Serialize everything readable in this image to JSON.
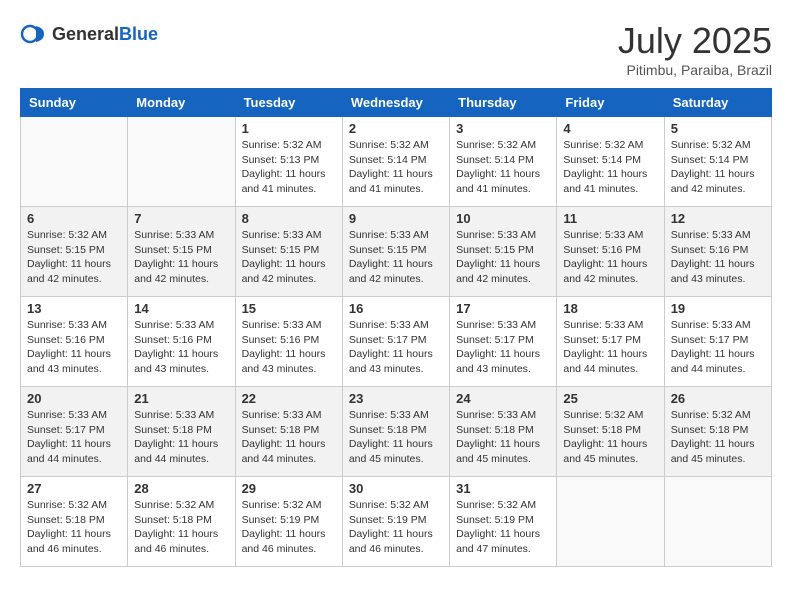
{
  "header": {
    "logo_general": "General",
    "logo_blue": "Blue",
    "month_year": "July 2025",
    "location": "Pitimbu, Paraiba, Brazil"
  },
  "days_of_week": [
    "Sunday",
    "Monday",
    "Tuesday",
    "Wednesday",
    "Thursday",
    "Friday",
    "Saturday"
  ],
  "weeks": [
    [
      {
        "day": "",
        "info": ""
      },
      {
        "day": "",
        "info": ""
      },
      {
        "day": "1",
        "info": "Sunrise: 5:32 AM\nSunset: 5:13 PM\nDaylight: 11 hours\nand 41 minutes."
      },
      {
        "day": "2",
        "info": "Sunrise: 5:32 AM\nSunset: 5:14 PM\nDaylight: 11 hours\nand 41 minutes."
      },
      {
        "day": "3",
        "info": "Sunrise: 5:32 AM\nSunset: 5:14 PM\nDaylight: 11 hours\nand 41 minutes."
      },
      {
        "day": "4",
        "info": "Sunrise: 5:32 AM\nSunset: 5:14 PM\nDaylight: 11 hours\nand 41 minutes."
      },
      {
        "day": "5",
        "info": "Sunrise: 5:32 AM\nSunset: 5:14 PM\nDaylight: 11 hours\nand 42 minutes."
      }
    ],
    [
      {
        "day": "6",
        "info": "Sunrise: 5:32 AM\nSunset: 5:15 PM\nDaylight: 11 hours\nand 42 minutes."
      },
      {
        "day": "7",
        "info": "Sunrise: 5:33 AM\nSunset: 5:15 PM\nDaylight: 11 hours\nand 42 minutes."
      },
      {
        "day": "8",
        "info": "Sunrise: 5:33 AM\nSunset: 5:15 PM\nDaylight: 11 hours\nand 42 minutes."
      },
      {
        "day": "9",
        "info": "Sunrise: 5:33 AM\nSunset: 5:15 PM\nDaylight: 11 hours\nand 42 minutes."
      },
      {
        "day": "10",
        "info": "Sunrise: 5:33 AM\nSunset: 5:15 PM\nDaylight: 11 hours\nand 42 minutes."
      },
      {
        "day": "11",
        "info": "Sunrise: 5:33 AM\nSunset: 5:16 PM\nDaylight: 11 hours\nand 42 minutes."
      },
      {
        "day": "12",
        "info": "Sunrise: 5:33 AM\nSunset: 5:16 PM\nDaylight: 11 hours\nand 43 minutes."
      }
    ],
    [
      {
        "day": "13",
        "info": "Sunrise: 5:33 AM\nSunset: 5:16 PM\nDaylight: 11 hours\nand 43 minutes."
      },
      {
        "day": "14",
        "info": "Sunrise: 5:33 AM\nSunset: 5:16 PM\nDaylight: 11 hours\nand 43 minutes."
      },
      {
        "day": "15",
        "info": "Sunrise: 5:33 AM\nSunset: 5:16 PM\nDaylight: 11 hours\nand 43 minutes."
      },
      {
        "day": "16",
        "info": "Sunrise: 5:33 AM\nSunset: 5:17 PM\nDaylight: 11 hours\nand 43 minutes."
      },
      {
        "day": "17",
        "info": "Sunrise: 5:33 AM\nSunset: 5:17 PM\nDaylight: 11 hours\nand 43 minutes."
      },
      {
        "day": "18",
        "info": "Sunrise: 5:33 AM\nSunset: 5:17 PM\nDaylight: 11 hours\nand 44 minutes."
      },
      {
        "day": "19",
        "info": "Sunrise: 5:33 AM\nSunset: 5:17 PM\nDaylight: 11 hours\nand 44 minutes."
      }
    ],
    [
      {
        "day": "20",
        "info": "Sunrise: 5:33 AM\nSunset: 5:17 PM\nDaylight: 11 hours\nand 44 minutes."
      },
      {
        "day": "21",
        "info": "Sunrise: 5:33 AM\nSunset: 5:18 PM\nDaylight: 11 hours\nand 44 minutes."
      },
      {
        "day": "22",
        "info": "Sunrise: 5:33 AM\nSunset: 5:18 PM\nDaylight: 11 hours\nand 44 minutes."
      },
      {
        "day": "23",
        "info": "Sunrise: 5:33 AM\nSunset: 5:18 PM\nDaylight: 11 hours\nand 45 minutes."
      },
      {
        "day": "24",
        "info": "Sunrise: 5:33 AM\nSunset: 5:18 PM\nDaylight: 11 hours\nand 45 minutes."
      },
      {
        "day": "25",
        "info": "Sunrise: 5:32 AM\nSunset: 5:18 PM\nDaylight: 11 hours\nand 45 minutes."
      },
      {
        "day": "26",
        "info": "Sunrise: 5:32 AM\nSunset: 5:18 PM\nDaylight: 11 hours\nand 45 minutes."
      }
    ],
    [
      {
        "day": "27",
        "info": "Sunrise: 5:32 AM\nSunset: 5:18 PM\nDaylight: 11 hours\nand 46 minutes."
      },
      {
        "day": "28",
        "info": "Sunrise: 5:32 AM\nSunset: 5:18 PM\nDaylight: 11 hours\nand 46 minutes."
      },
      {
        "day": "29",
        "info": "Sunrise: 5:32 AM\nSunset: 5:19 PM\nDaylight: 11 hours\nand 46 minutes."
      },
      {
        "day": "30",
        "info": "Sunrise: 5:32 AM\nSunset: 5:19 PM\nDaylight: 11 hours\nand 46 minutes."
      },
      {
        "day": "31",
        "info": "Sunrise: 5:32 AM\nSunset: 5:19 PM\nDaylight: 11 hours\nand 47 minutes."
      },
      {
        "day": "",
        "info": ""
      },
      {
        "day": "",
        "info": ""
      }
    ]
  ]
}
